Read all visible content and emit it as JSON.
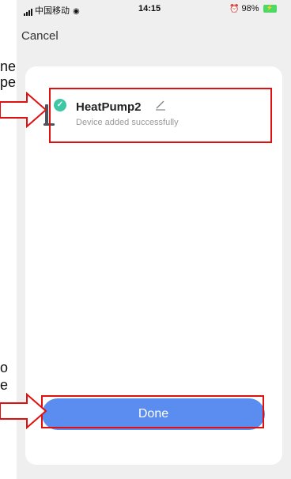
{
  "status_bar": {
    "carrier": "中国移动",
    "time": "14:15",
    "battery": "98%"
  },
  "nav": {
    "cancel_label": "Cancel"
  },
  "device": {
    "name": "HeatPump2",
    "status": "Device added successfully",
    "icon": "floor-lamp-icon",
    "check_icon": "check-icon",
    "edit_icon": "pencil-icon"
  },
  "done_label": "Done",
  "annotation_fragments": {
    "top_line1": "ne",
    "top_line2": "pe",
    "bottom_line1": "o",
    "bottom_line2": "e"
  },
  "colors": {
    "done_button": "#5b8cef",
    "check_badge": "#3ec7a4",
    "annotation_red": "#e01010",
    "background": "#efefef"
  }
}
